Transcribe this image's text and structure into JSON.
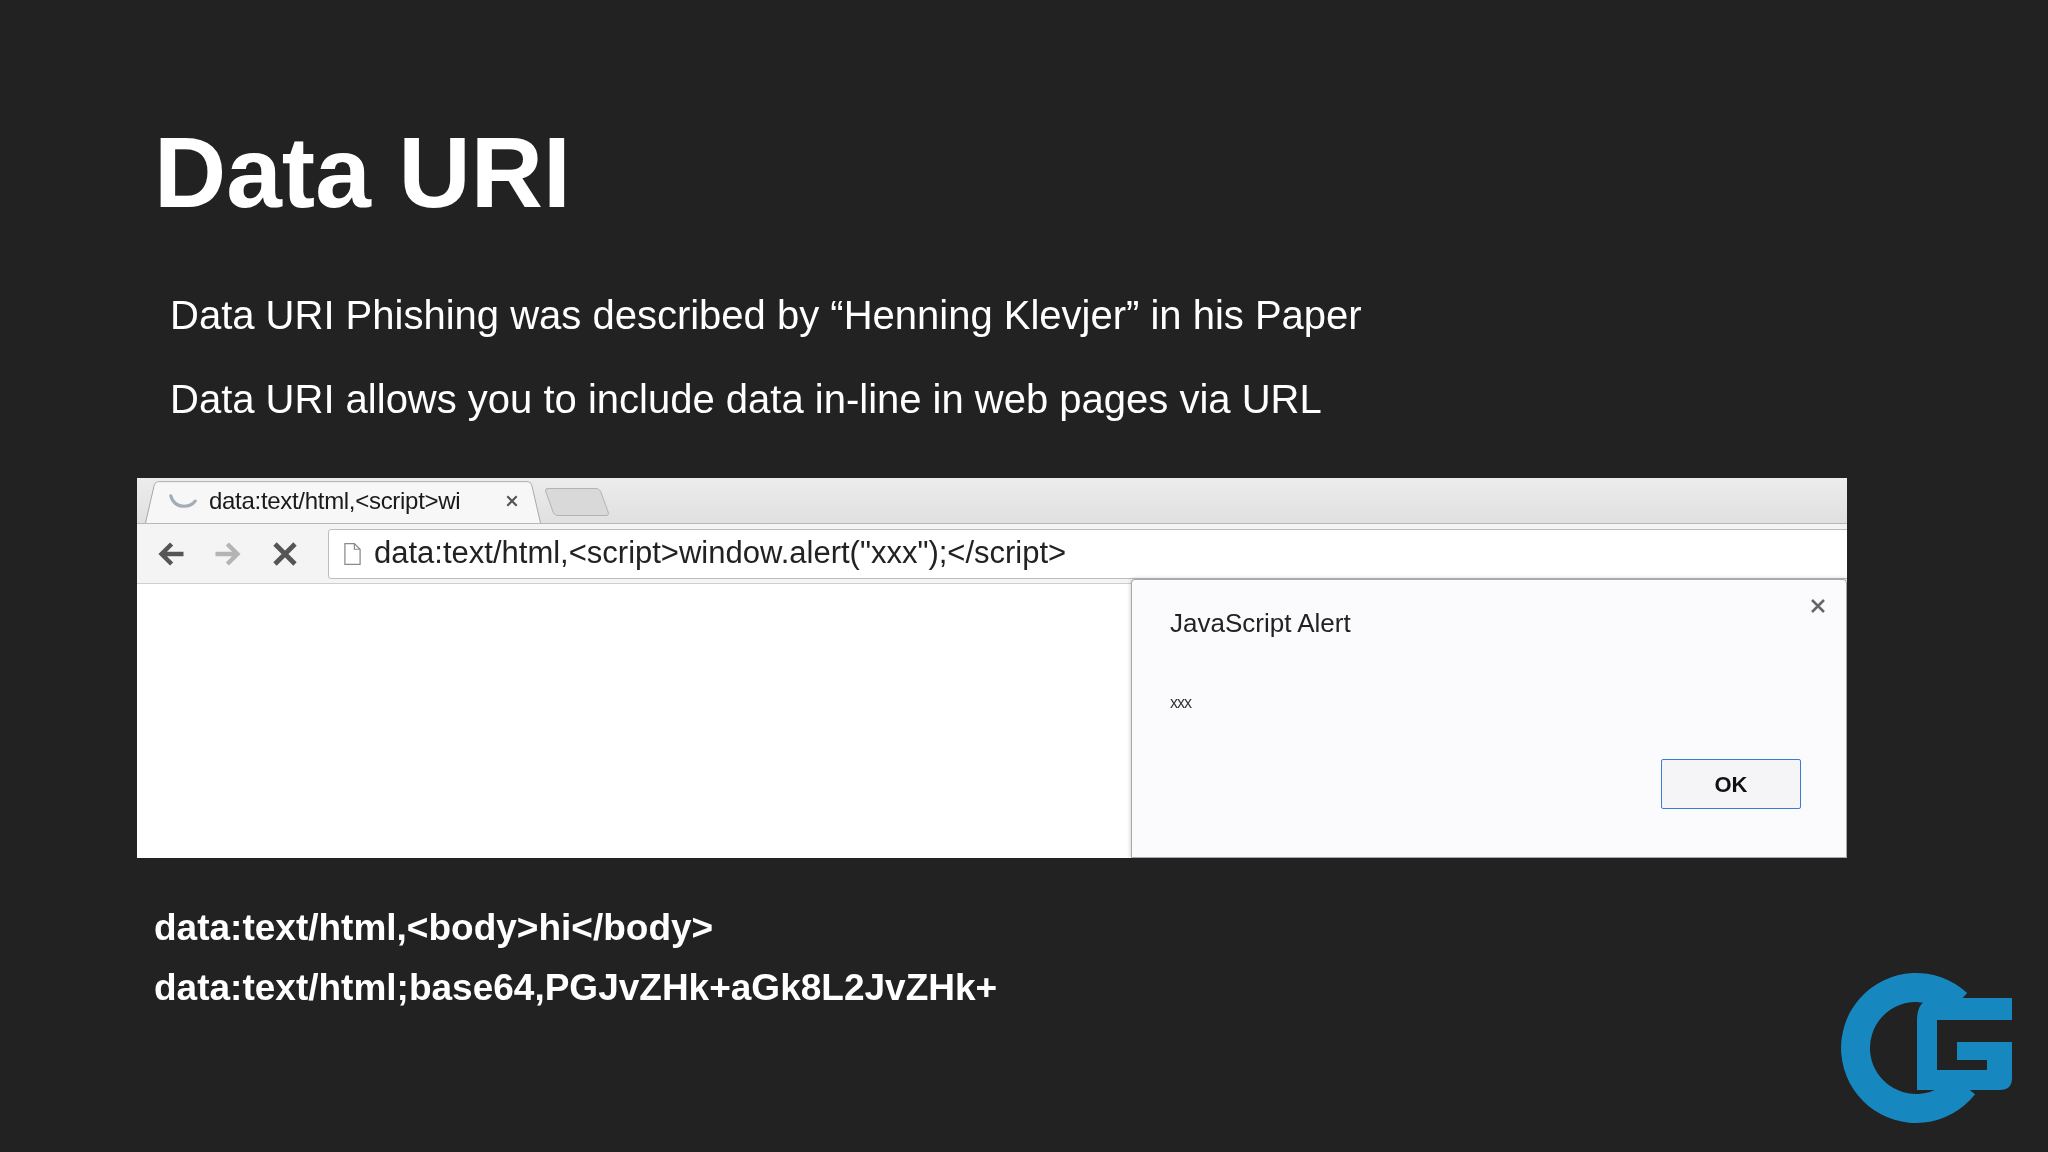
{
  "slide": {
    "title": "Data URI",
    "bullets": [
      "Data URI Phishing was described by “Henning Klevjer” in his Paper",
      "Data URI allows you to include data in-line in web pages via URL"
    ]
  },
  "browser": {
    "tabs": [
      {
        "title": "data:text/html,<script>wi",
        "selected": true,
        "loading": true
      }
    ],
    "nav_buttons": [
      {
        "kind": "back",
        "disabled": false
      },
      {
        "kind": "forward",
        "disabled": true
      },
      {
        "kind": "stop",
        "disabled": false
      }
    ],
    "address": {
      "value": "data:text/html,<script>window.alert(\"xxx\");</script>"
    },
    "alert": {
      "title": "JavaScript Alert",
      "message": "xxx",
      "buttons": [
        "OK"
      ]
    }
  },
  "code_examples": [
    "data:text/html,<body>hi</body>",
    "data:text/html;base64,PGJvZHk+aGk8L2JvZHk+"
  ]
}
